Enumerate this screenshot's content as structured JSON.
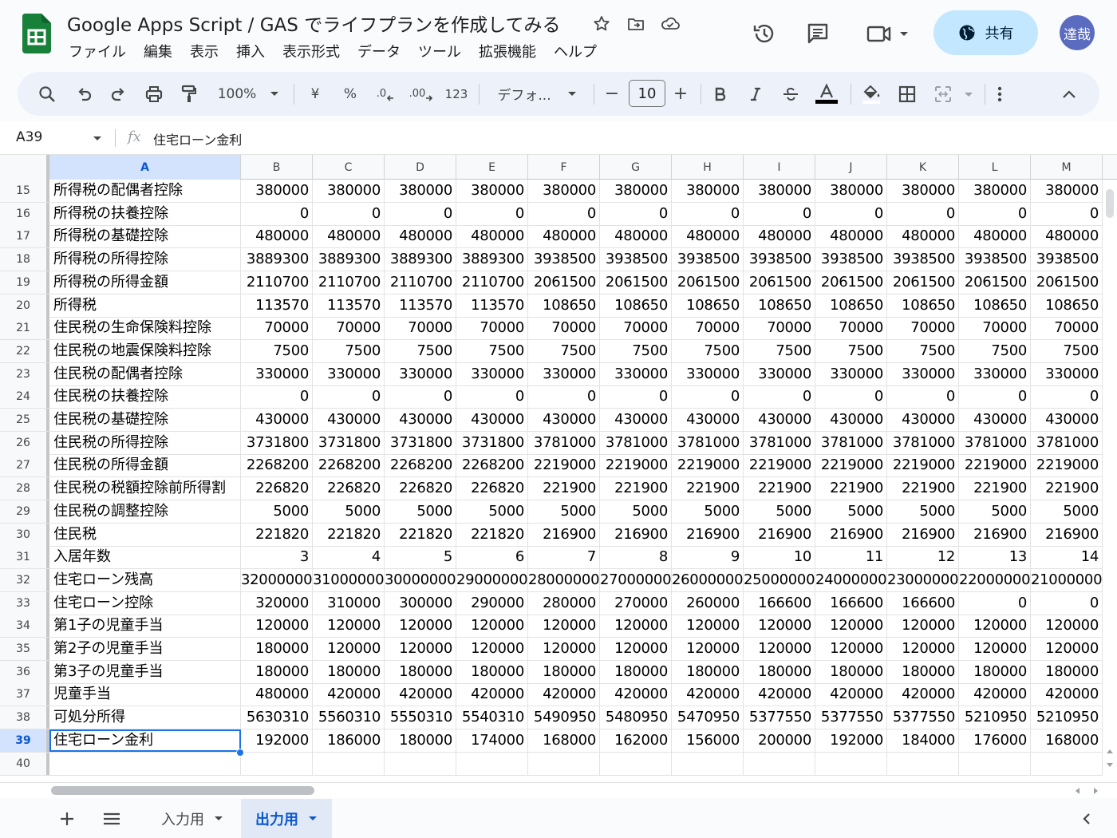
{
  "colors": {
    "accent": "#1a73e8",
    "share_bg": "#c2e7ff",
    "avatar_bg": "#5b6bbf",
    "sheets_green": "#188038"
  },
  "document": {
    "title": "Google Apps Script / GAS でライフプランを作成してみる"
  },
  "menu": [
    "ファイル",
    "編集",
    "表示",
    "挿入",
    "表示形式",
    "データ",
    "ツール",
    "拡張機能",
    "ヘルプ"
  ],
  "header": {
    "share_label": "共有",
    "avatar_text": "達哉"
  },
  "toolbar": {
    "zoom": "100%",
    "currency": "¥",
    "percent": "%",
    "decimal_decrease": ".0",
    "decimal_increase": ".00",
    "number_format": "123",
    "font": "デフォ...",
    "font_size": "10",
    "minus": "−",
    "plus": "+"
  },
  "formula_bar": {
    "cell_ref": "A39",
    "fx": "fx",
    "content": "住宅ローン金利"
  },
  "columns": [
    "A",
    "B",
    "C",
    "D",
    "E",
    "F",
    "G",
    "H",
    "I",
    "J",
    "K",
    "L",
    "M"
  ],
  "rows": [
    {
      "num": "15",
      "label": "所得税の配偶者控除",
      "values": [
        "380000",
        "380000",
        "380000",
        "380000",
        "380000",
        "380000",
        "380000",
        "380000",
        "380000",
        "380000",
        "380000",
        "380000"
      ]
    },
    {
      "num": "16",
      "label": "所得税の扶養控除",
      "values": [
        "0",
        "0",
        "0",
        "0",
        "0",
        "0",
        "0",
        "0",
        "0",
        "0",
        "0",
        "0"
      ]
    },
    {
      "num": "17",
      "label": "所得税の基礎控除",
      "values": [
        "480000",
        "480000",
        "480000",
        "480000",
        "480000",
        "480000",
        "480000",
        "480000",
        "480000",
        "480000",
        "480000",
        "480000"
      ]
    },
    {
      "num": "18",
      "label": "所得税の所得控除",
      "values": [
        "3889300",
        "3889300",
        "3889300",
        "3889300",
        "3938500",
        "3938500",
        "3938500",
        "3938500",
        "3938500",
        "3938500",
        "3938500",
        "3938500"
      ]
    },
    {
      "num": "19",
      "label": "所得税の所得金額",
      "values": [
        "2110700",
        "2110700",
        "2110700",
        "2110700",
        "2061500",
        "2061500",
        "2061500",
        "2061500",
        "2061500",
        "2061500",
        "2061500",
        "2061500"
      ]
    },
    {
      "num": "20",
      "label": "所得税",
      "values": [
        "113570",
        "113570",
        "113570",
        "113570",
        "108650",
        "108650",
        "108650",
        "108650",
        "108650",
        "108650",
        "108650",
        "108650"
      ]
    },
    {
      "num": "21",
      "label": "住民税の生命保険料控除",
      "values": [
        "70000",
        "70000",
        "70000",
        "70000",
        "70000",
        "70000",
        "70000",
        "70000",
        "70000",
        "70000",
        "70000",
        "70000"
      ]
    },
    {
      "num": "22",
      "label": "住民税の地震保険料控除",
      "values": [
        "7500",
        "7500",
        "7500",
        "7500",
        "7500",
        "7500",
        "7500",
        "7500",
        "7500",
        "7500",
        "7500",
        "7500"
      ]
    },
    {
      "num": "23",
      "label": "住民税の配偶者控除",
      "values": [
        "330000",
        "330000",
        "330000",
        "330000",
        "330000",
        "330000",
        "330000",
        "330000",
        "330000",
        "330000",
        "330000",
        "330000"
      ]
    },
    {
      "num": "24",
      "label": "住民税の扶養控除",
      "values": [
        "0",
        "0",
        "0",
        "0",
        "0",
        "0",
        "0",
        "0",
        "0",
        "0",
        "0",
        "0"
      ]
    },
    {
      "num": "25",
      "label": "住民税の基礎控除",
      "values": [
        "430000",
        "430000",
        "430000",
        "430000",
        "430000",
        "430000",
        "430000",
        "430000",
        "430000",
        "430000",
        "430000",
        "430000"
      ]
    },
    {
      "num": "26",
      "label": "住民税の所得控除",
      "values": [
        "3731800",
        "3731800",
        "3731800",
        "3731800",
        "3781000",
        "3781000",
        "3781000",
        "3781000",
        "3781000",
        "3781000",
        "3781000",
        "3781000"
      ]
    },
    {
      "num": "27",
      "label": "住民税の所得金額",
      "values": [
        "2268200",
        "2268200",
        "2268200",
        "2268200",
        "2219000",
        "2219000",
        "2219000",
        "2219000",
        "2219000",
        "2219000",
        "2219000",
        "2219000"
      ]
    },
    {
      "num": "28",
      "label": "住民税の税額控除前所得割",
      "values": [
        "226820",
        "226820",
        "226820",
        "226820",
        "221900",
        "221900",
        "221900",
        "221900",
        "221900",
        "221900",
        "221900",
        "221900"
      ]
    },
    {
      "num": "29",
      "label": "住民税の調整控除",
      "values": [
        "5000",
        "5000",
        "5000",
        "5000",
        "5000",
        "5000",
        "5000",
        "5000",
        "5000",
        "5000",
        "5000",
        "5000"
      ]
    },
    {
      "num": "30",
      "label": "住民税",
      "values": [
        "221820",
        "221820",
        "221820",
        "221820",
        "216900",
        "216900",
        "216900",
        "216900",
        "216900",
        "216900",
        "216900",
        "216900"
      ]
    },
    {
      "num": "31",
      "label": "入居年数",
      "values": [
        "3",
        "4",
        "5",
        "6",
        "7",
        "8",
        "9",
        "10",
        "11",
        "12",
        "13",
        "14"
      ]
    },
    {
      "num": "32",
      "label": "住宅ローン残高",
      "values": [
        "32000000",
        "31000000",
        "30000000",
        "29000000",
        "28000000",
        "27000000",
        "26000000",
        "25000000",
        "24000000",
        "23000000",
        "22000000",
        "21000000"
      ]
    },
    {
      "num": "33",
      "label": "住宅ローン控除",
      "values": [
        "320000",
        "310000",
        "300000",
        "290000",
        "280000",
        "270000",
        "260000",
        "166600",
        "166600",
        "166600",
        "0",
        "0"
      ]
    },
    {
      "num": "34",
      "label": "第1子の児童手当",
      "values": [
        "120000",
        "120000",
        "120000",
        "120000",
        "120000",
        "120000",
        "120000",
        "120000",
        "120000",
        "120000",
        "120000",
        "120000"
      ]
    },
    {
      "num": "35",
      "label": "第2子の児童手当",
      "values": [
        "180000",
        "120000",
        "120000",
        "120000",
        "120000",
        "120000",
        "120000",
        "120000",
        "120000",
        "120000",
        "120000",
        "120000"
      ]
    },
    {
      "num": "36",
      "label": "第3子の児童手当",
      "values": [
        "180000",
        "180000",
        "180000",
        "180000",
        "180000",
        "180000",
        "180000",
        "180000",
        "180000",
        "180000",
        "180000",
        "180000"
      ]
    },
    {
      "num": "37",
      "label": "児童手当",
      "values": [
        "480000",
        "420000",
        "420000",
        "420000",
        "420000",
        "420000",
        "420000",
        "420000",
        "420000",
        "420000",
        "420000",
        "420000"
      ]
    },
    {
      "num": "38",
      "label": "可処分所得",
      "values": [
        "5630310",
        "5560310",
        "5550310",
        "5540310",
        "5490950",
        "5480950",
        "5470950",
        "5377550",
        "5377550",
        "5377550",
        "5210950",
        "5210950"
      ]
    },
    {
      "num": "39",
      "label": "住宅ローン金利",
      "values": [
        "192000",
        "186000",
        "180000",
        "174000",
        "168000",
        "162000",
        "156000",
        "200000",
        "192000",
        "184000",
        "176000",
        "168000"
      ]
    },
    {
      "num": "40",
      "label": "",
      "values": [
        "",
        "",
        "",
        "",
        "",
        "",
        "",
        "",
        "",
        "",
        "",
        ""
      ]
    }
  ],
  "selection": {
    "row": "39",
    "col": "A"
  },
  "sheets": [
    {
      "name": "入力用",
      "active": false
    },
    {
      "name": "出力用",
      "active": true
    }
  ]
}
